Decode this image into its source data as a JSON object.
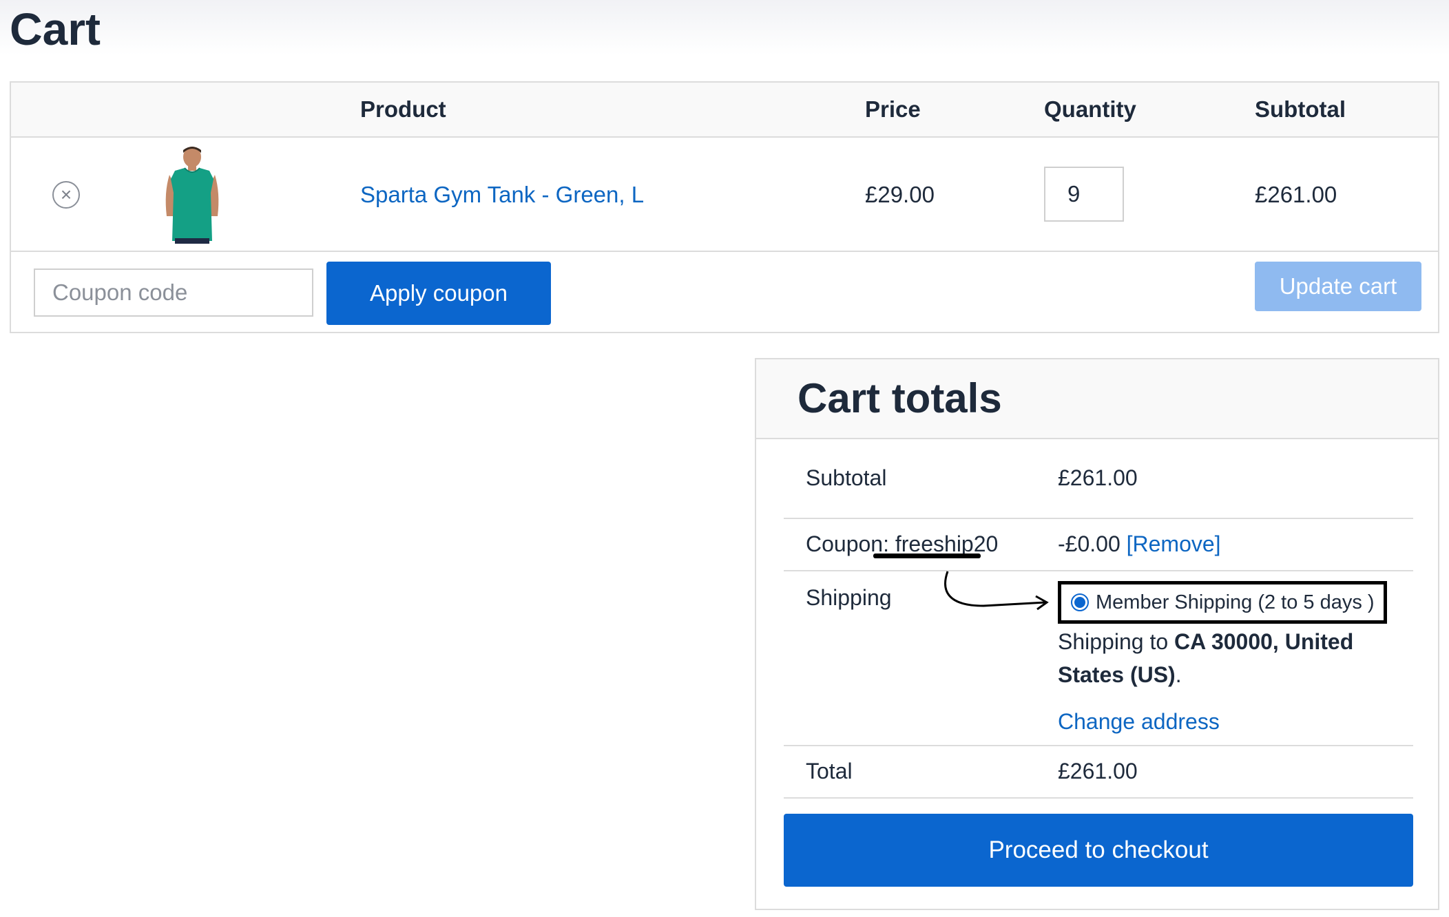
{
  "page": {
    "title": "Cart"
  },
  "cart_table": {
    "headers": {
      "product": "Product",
      "price": "Price",
      "quantity": "Quantity",
      "subtotal": "Subtotal"
    },
    "items": [
      {
        "remove_icon": "close-circle-icon",
        "thumbnail": "green-tank-top-image",
        "name": "Sparta Gym Tank - Green, L",
        "price": "£29.00",
        "quantity": "9",
        "subtotal": "£261.00"
      }
    ],
    "coupon_placeholder": "Coupon code",
    "apply_coupon_label": "Apply coupon",
    "update_cart_label": "Update cart"
  },
  "cart_totals": {
    "title": "Cart totals",
    "subtotal_label": "Subtotal",
    "subtotal_value": "£261.00",
    "coupon_prefix": "Coupon: ",
    "coupon_code": "freeship20",
    "coupon_discount": "-£0.00",
    "coupon_remove": "[Remove]",
    "shipping_label": "Shipping",
    "shipping_method": "Member Shipping (2 to 5 days )",
    "shipping_to_prefix": "Shipping to ",
    "shipping_destination": "CA 30000, United States (US)",
    "shipping_to_suffix": ".",
    "change_address": "Change address",
    "total_label": "Total",
    "total_value": "£261.00",
    "checkout_label": "Proceed to checkout"
  },
  "colors": {
    "accent": "#0b66cf",
    "link": "#0d66c2",
    "update_disabled": "#8fbaf0",
    "text": "#1e2a3b",
    "border": "#dcdcdc",
    "header_bg": "#f9f9f9"
  }
}
